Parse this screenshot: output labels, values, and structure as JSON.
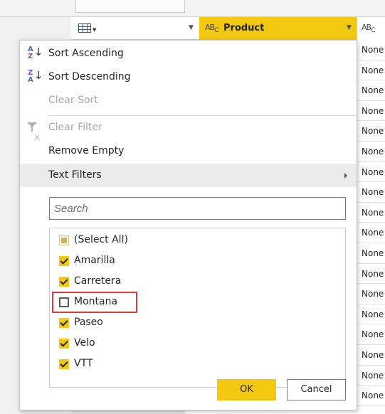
{
  "column_header": {
    "column_name": "Product",
    "type_icon_text": "AB",
    "type_icon_sub": "C"
  },
  "column_cells": [
    "None",
    "None",
    "None",
    "None",
    "None",
    "None",
    "None",
    "None",
    "None",
    "None",
    "None",
    "None",
    "None",
    "None",
    "None",
    "None",
    "None",
    "None"
  ],
  "menu": {
    "sort_ascending": "Sort Ascending",
    "sort_descending": "Sort Descending",
    "clear_sort": "Clear Sort",
    "clear_filter": "Clear Filter",
    "remove_empty": "Remove Empty",
    "text_filters": "Text Filters"
  },
  "search": {
    "placeholder": "Search"
  },
  "filter_list": {
    "items": [
      {
        "label": "(Select All)",
        "state": "indeterminate"
      },
      {
        "label": "Amarilla",
        "state": "checked"
      },
      {
        "label": "Carretera",
        "state": "checked"
      },
      {
        "label": "Montana",
        "state": "unchecked"
      },
      {
        "label": "Paseo",
        "state": "checked"
      },
      {
        "label": "Velo",
        "state": "checked"
      },
      {
        "label": "VTT",
        "state": "checked"
      }
    ]
  },
  "buttons": {
    "ok": "OK",
    "cancel": "Cancel"
  },
  "colors": {
    "accent": "#f2c811",
    "highlight_border": "#e0393e"
  }
}
